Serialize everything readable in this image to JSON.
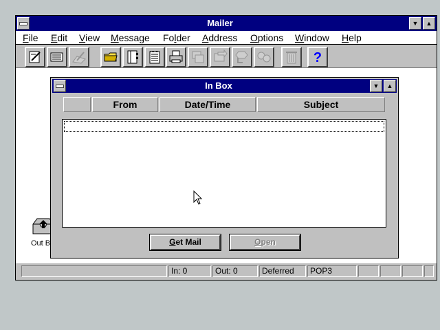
{
  "main_window": {
    "title": "Mailer",
    "menu": [
      {
        "label": "File",
        "underline": "F",
        "rest": "ile"
      },
      {
        "label": "Edit",
        "underline": "E",
        "rest": "dit"
      },
      {
        "label": "View",
        "underline": "V",
        "rest": "iew"
      },
      {
        "label": "Message",
        "underline": "M",
        "rest": "essage"
      },
      {
        "label": "Folder",
        "pre": "Fo",
        "underline": "l",
        "rest": "der"
      },
      {
        "label": "Address",
        "underline": "A",
        "rest": "ddress"
      },
      {
        "label": "Options",
        "underline": "O",
        "rest": "ptions"
      },
      {
        "label": "Window",
        "underline": "W",
        "rest": "indow"
      },
      {
        "label": "Help",
        "underline": "H",
        "rest": "elp"
      }
    ],
    "toolbar": [
      {
        "icon": "compose-icon",
        "enabled": true
      },
      {
        "icon": "read-message-icon",
        "enabled": true
      },
      {
        "icon": "edit-message-icon",
        "enabled": false
      },
      {
        "icon": "folder-icon",
        "enabled": true
      },
      {
        "icon": "address-book-icon",
        "enabled": true
      },
      {
        "icon": "notepad-icon",
        "enabled": true
      },
      {
        "icon": "print-icon",
        "enabled": true
      },
      {
        "icon": "file-message-icon",
        "enabled": false
      },
      {
        "icon": "forward-icon",
        "enabled": false
      },
      {
        "icon": "reply-icon",
        "enabled": false
      },
      {
        "icon": "reply-all-icon",
        "enabled": false
      },
      {
        "icon": "trash-icon",
        "enabled": false
      },
      {
        "icon": "help-icon",
        "enabled": true
      }
    ],
    "status": {
      "in": "In: 0",
      "out": "Out: 0",
      "mode": "Deferred",
      "protocol": "POP3"
    }
  },
  "inbox": {
    "title": "In Box",
    "columns": [
      "From",
      "Date/Time",
      "Subject"
    ],
    "messages": [],
    "get_mail": {
      "underline": "G",
      "rest": "et Mail"
    },
    "open": {
      "underline": "O",
      "rest": "pen",
      "enabled": false
    }
  },
  "desktop": {
    "outbox_label": "Out Bo"
  },
  "colors": {
    "titlebar": "#000080",
    "face": "#c0c0c0",
    "desktop": "#c0c7c8",
    "help_icon": "#0000ff"
  }
}
